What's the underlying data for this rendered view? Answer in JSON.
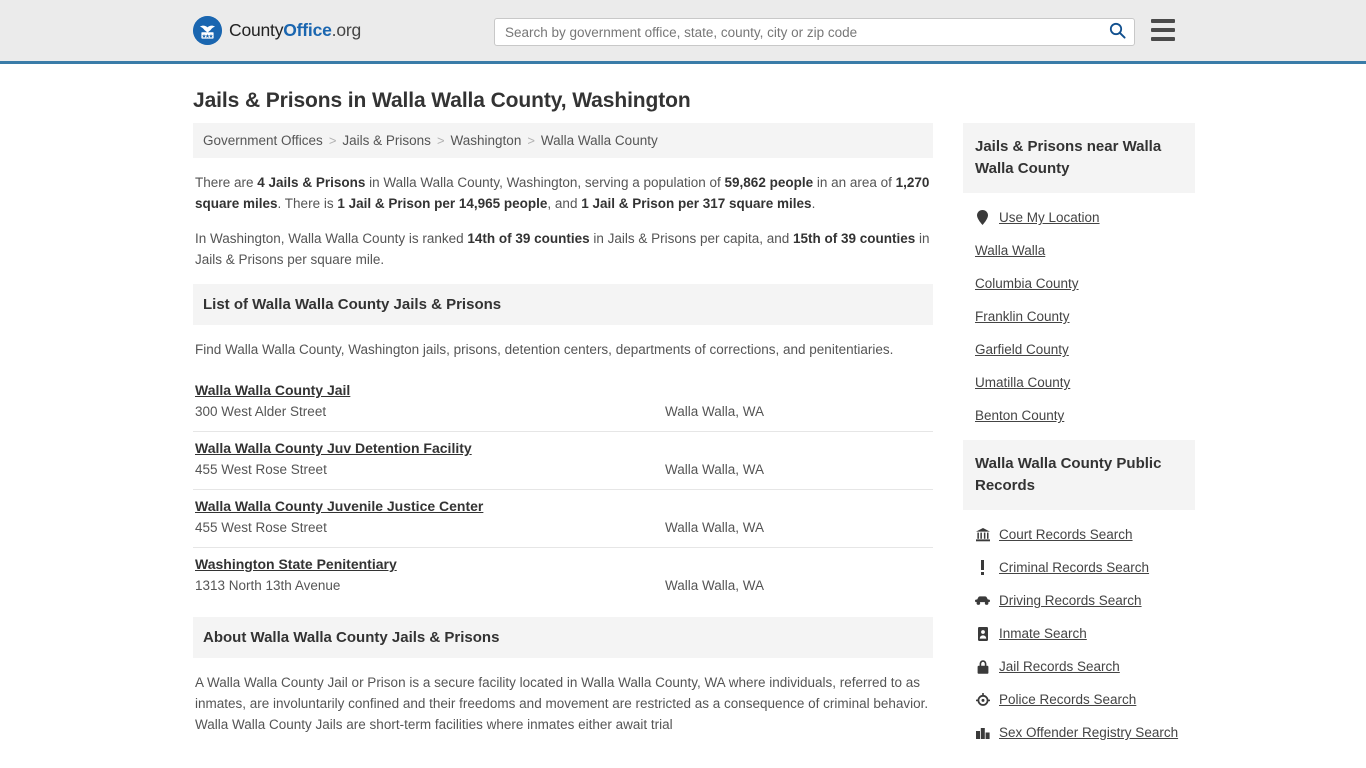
{
  "header": {
    "logo": {
      "part1": "County",
      "part2": "Office",
      "part3": ".org",
      "icon": "eagle-shield-logo-icon"
    },
    "search": {
      "placeholder": "Search by government office, state, county, city or zip code",
      "value": "",
      "search_icon": "search-icon"
    },
    "menu_icon": "hamburger-menu-icon"
  },
  "page": {
    "title": "Jails & Prisons in Walla Walla County, Washington"
  },
  "breadcrumb": {
    "items": [
      {
        "label": "Government Offices",
        "link": true
      },
      {
        "label": "Jails & Prisons",
        "link": true
      },
      {
        "label": "Washington",
        "link": true
      },
      {
        "label": "Walla Walla County",
        "link": false
      }
    ],
    "separator": ">"
  },
  "intro": {
    "p1": {
      "s1": "There are ",
      "b1": "4 Jails & Prisons",
      "s2": " in Walla Walla County, Washington, serving a population of ",
      "b2": "59,862 people",
      "s3": " in an area of ",
      "b3": "1,270 square miles",
      "s4": ". There is ",
      "b4": "1 Jail & Prison per 14,965 people",
      "s5": ", and ",
      "b5": "1 Jail & Prison per 317 square miles",
      "s6": "."
    },
    "p2": {
      "s1": "In Washington, Walla Walla County is ranked ",
      "b1": "14th of 39 counties",
      "s2": " in Jails & Prisons per capita, and ",
      "b2": "15th of 39 counties",
      "s3": " in Jails & Prisons per square mile."
    }
  },
  "list_section": {
    "heading": "List of Walla Walla County Jails & Prisons",
    "description": "Find Walla Walla County, Washington jails, prisons, detention centers, departments of corrections, and penitentiaries.",
    "rows": [
      {
        "name": "Walla Walla County Jail",
        "address": "300 West Alder Street",
        "city": "Walla Walla, WA"
      },
      {
        "name": "Walla Walla County Juv Detention Facility",
        "address": "455 West Rose Street",
        "city": "Walla Walla, WA"
      },
      {
        "name": "Walla Walla County Juvenile Justice Center",
        "address": "455 West Rose Street",
        "city": "Walla Walla, WA"
      },
      {
        "name": "Washington State Penitentiary",
        "address": "1313 North 13th Avenue",
        "city": "Walla Walla, WA"
      }
    ]
  },
  "about_section": {
    "heading": "About Walla Walla County Jails & Prisons",
    "body": "A Walla Walla County Jail or Prison is a secure facility located in Walla Walla County, WA where individuals, referred to as inmates, are involuntarily confined and their freedoms and movement are restricted as a consequence of criminal behavior. Walla Walla County Jails are short-term facilities where inmates either await trial"
  },
  "sidebar": {
    "nearby": {
      "heading": "Jails & Prisons near Walla Walla County",
      "items": [
        {
          "label": "Use My Location",
          "icon": "map-pin-icon"
        },
        {
          "label": "Walla Walla",
          "icon": ""
        },
        {
          "label": "Columbia County",
          "icon": ""
        },
        {
          "label": "Franklin County",
          "icon": ""
        },
        {
          "label": "Garfield County",
          "icon": ""
        },
        {
          "label": "Umatilla County",
          "icon": ""
        },
        {
          "label": "Benton County",
          "icon": ""
        }
      ]
    },
    "records": {
      "heading": "Walla Walla County Public Records",
      "items": [
        {
          "label": "Court Records Search",
          "icon": "courthouse-icon"
        },
        {
          "label": "Criminal Records Search",
          "icon": "exclamation-icon"
        },
        {
          "label": "Driving Records Search",
          "icon": "car-icon"
        },
        {
          "label": "Inmate Search",
          "icon": "id-badge-icon"
        },
        {
          "label": "Jail Records Search",
          "icon": "lock-icon"
        },
        {
          "label": "Police Records Search",
          "icon": "police-badge-icon"
        },
        {
          "label": "Sex Offender Registry Search",
          "icon": "buildings-icon"
        }
      ]
    }
  },
  "colors": {
    "header_bg": "#ebebeb",
    "header_border": "#3a7ca8",
    "brand_blue": "#1a66b0",
    "panel_bg": "#f4f4f4",
    "text": "#333333",
    "muted": "#555555"
  }
}
